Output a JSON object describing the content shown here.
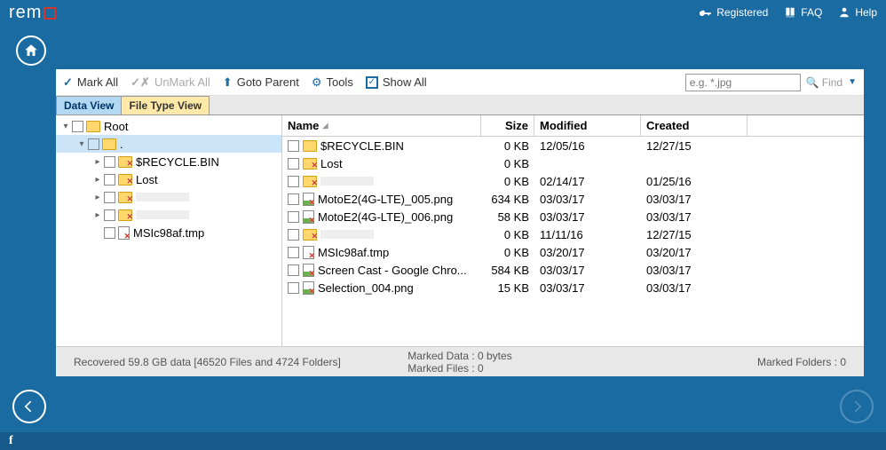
{
  "titlebar": {
    "logo": "rem",
    "registered": "Registered",
    "faq": "FAQ",
    "help": "Help"
  },
  "toolbar": {
    "mark_all": "Mark All",
    "unmark_all": "UnMark All",
    "goto_parent": "Goto Parent",
    "tools": "Tools",
    "show_all": "Show All",
    "search_placeholder": "e.g. *.jpg",
    "find": "Find"
  },
  "tabs": {
    "data_view": "Data View",
    "file_type_view": "File Type View"
  },
  "tree": [
    {
      "level": 0,
      "toggle": "▾",
      "icon": "folder",
      "label": "Root",
      "selected": false
    },
    {
      "level": 1,
      "toggle": "▾",
      "icon": "folder",
      "label": ".",
      "selected": true
    },
    {
      "level": 2,
      "toggle": "▸",
      "icon": "folder-x",
      "label": "$RECYCLE.BIN",
      "selected": false
    },
    {
      "level": 2,
      "toggle": "▸",
      "icon": "folder-x",
      "label": "Lost",
      "selected": false
    },
    {
      "level": 2,
      "toggle": "▸",
      "icon": "folder-x",
      "label": "",
      "selected": false,
      "blurred": true
    },
    {
      "level": 2,
      "toggle": "▸",
      "icon": "folder-x",
      "label": "",
      "selected": false,
      "blurred": true
    },
    {
      "level": 2,
      "toggle": "",
      "icon": "file-x",
      "label": "MSIc98af.tmp",
      "selected": false
    }
  ],
  "columns": {
    "name": "Name",
    "size": "Size",
    "modified": "Modified",
    "created": "Created"
  },
  "rows": [
    {
      "icon": "folder",
      "name": "$RECYCLE.BIN",
      "size": "0 KB",
      "modified": "12/05/16",
      "created": "12/27/15"
    },
    {
      "icon": "folder-x",
      "name": "Lost",
      "size": "0 KB",
      "modified": "",
      "created": ""
    },
    {
      "icon": "folder-x",
      "name": "",
      "size": "0 KB",
      "modified": "02/14/17",
      "created": "01/25/16",
      "blurred": true
    },
    {
      "icon": "png-x",
      "name": "MotoE2(4G-LTE)_005.png",
      "size": "634 KB",
      "modified": "03/03/17",
      "created": "03/03/17"
    },
    {
      "icon": "png-x",
      "name": "MotoE2(4G-LTE)_006.png",
      "size": "58 KB",
      "modified": "03/03/17",
      "created": "03/03/17"
    },
    {
      "icon": "folder-x",
      "name": "",
      "size": "0 KB",
      "modified": "11/11/16",
      "created": "12/27/15",
      "blurred": true
    },
    {
      "icon": "file-x",
      "name": "MSIc98af.tmp",
      "size": "0 KB",
      "modified": "03/20/17",
      "created": "03/20/17"
    },
    {
      "icon": "png-x",
      "name": "Screen Cast - Google Chro...",
      "size": "584 KB",
      "modified": "03/03/17",
      "created": "03/03/17"
    },
    {
      "icon": "png-x",
      "name": "Selection_004.png",
      "size": "15 KB",
      "modified": "03/03/17",
      "created": "03/03/17"
    }
  ],
  "status": {
    "recovered": "Recovered 59.8 GB data [46520 Files and 4724 Folders]",
    "marked_data": "Marked Data : 0 bytes",
    "marked_files": "Marked Files : 0",
    "marked_folders": "Marked Folders : 0"
  }
}
